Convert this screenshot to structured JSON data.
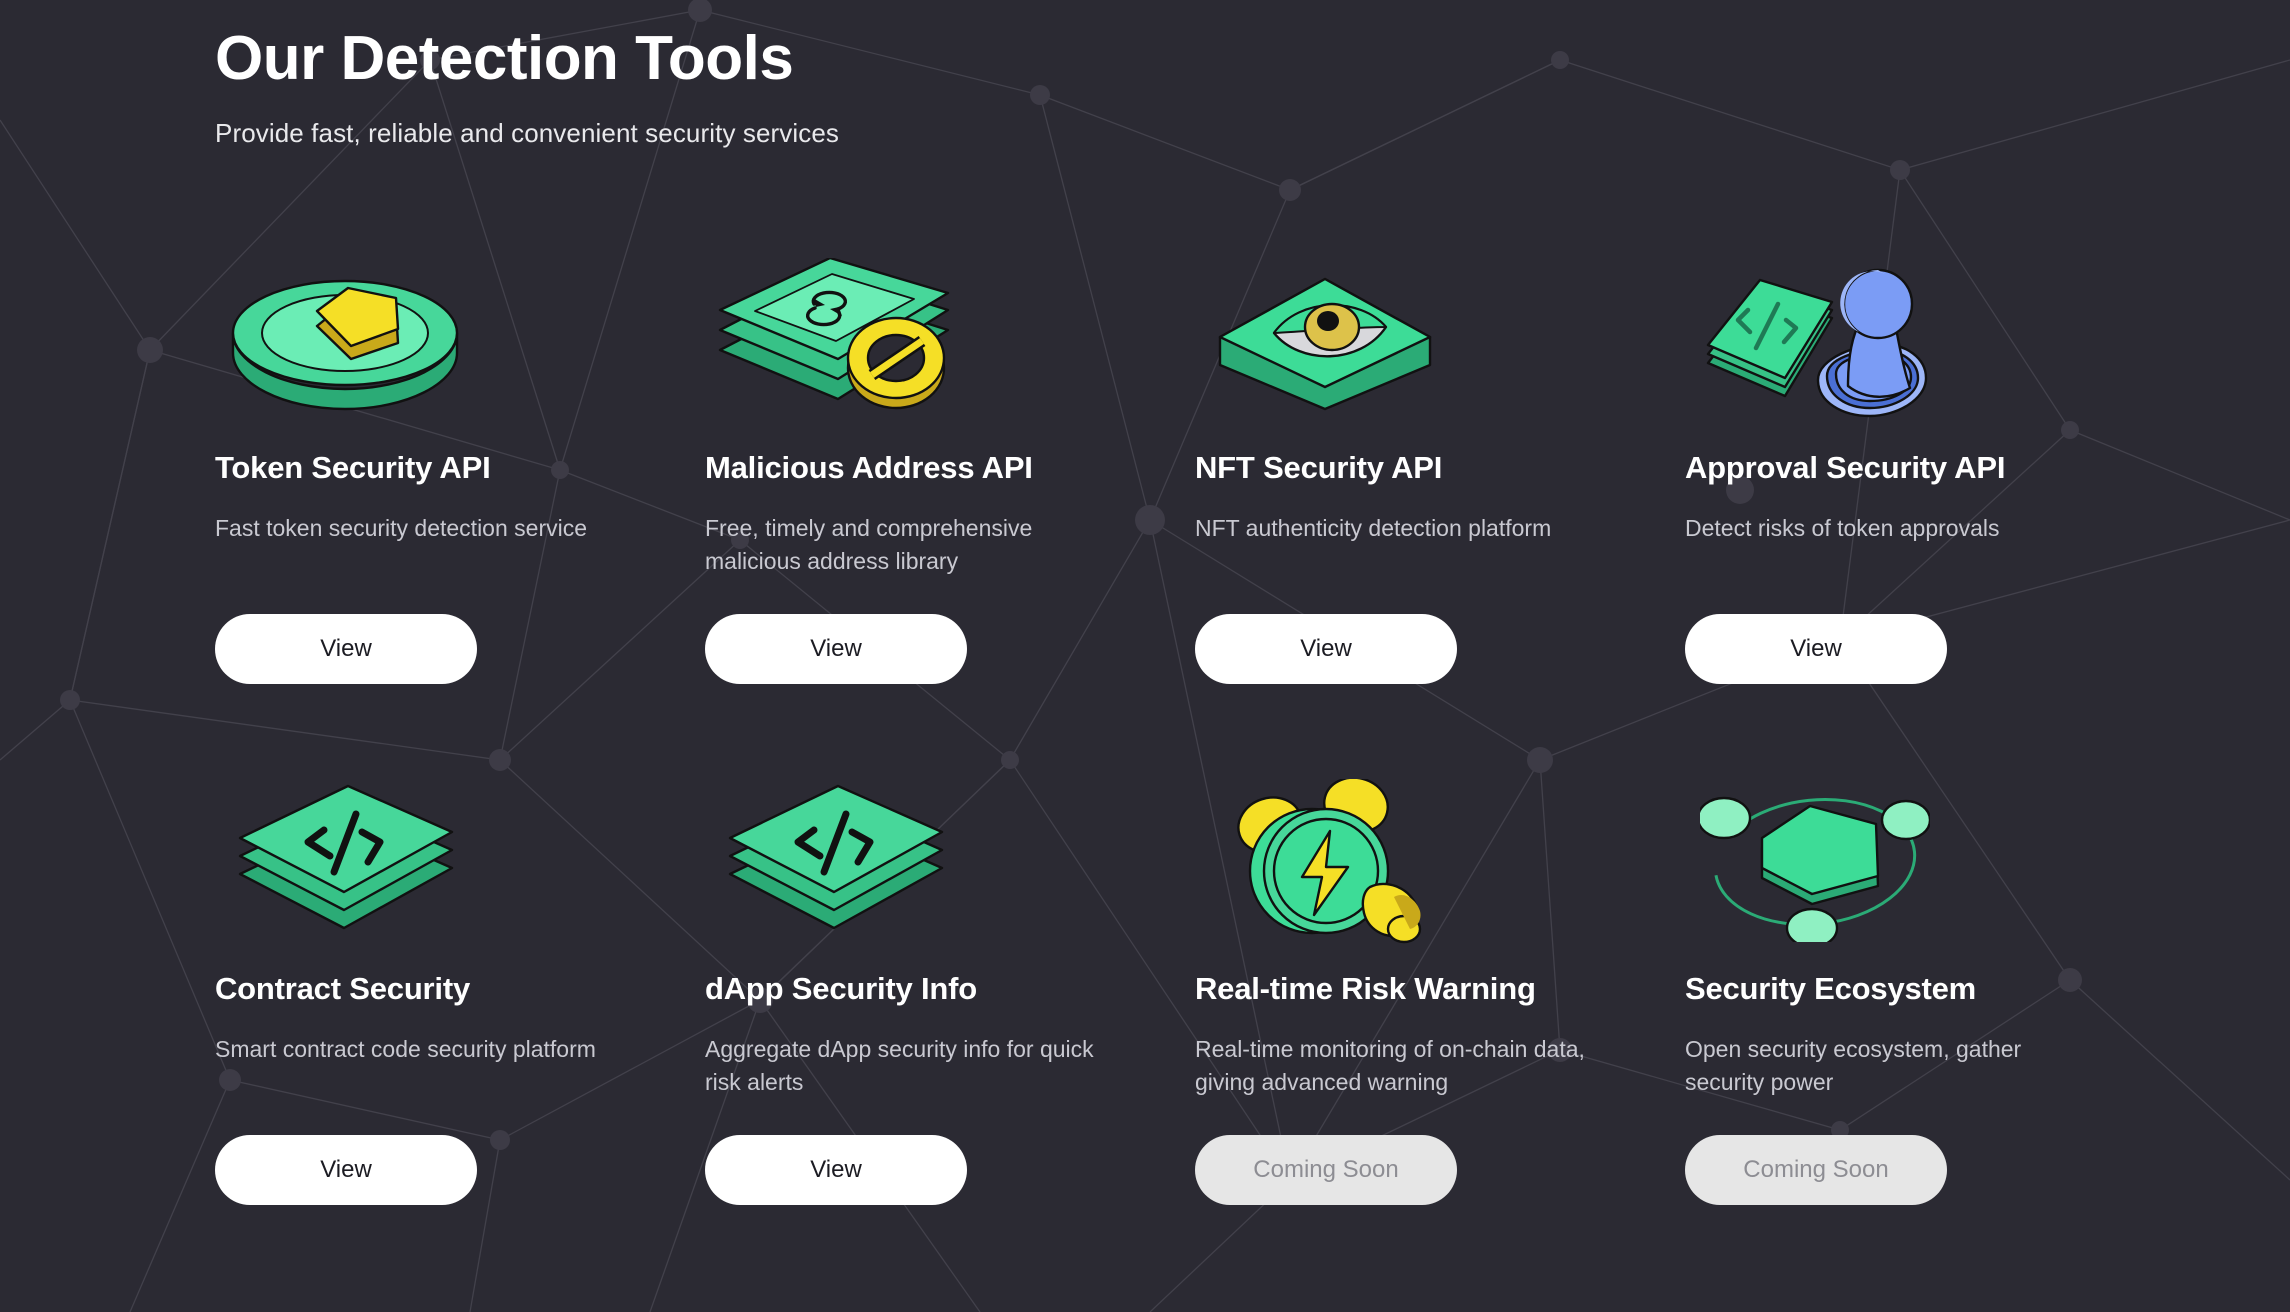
{
  "header": {
    "title": "Our Detection Tools",
    "subtitle": "Provide fast, reliable and convenient security services"
  },
  "colors": {
    "background": "#2b2a33",
    "title_text": "#ffffff",
    "body_text": "#c9c9d1",
    "button_active_bg": "#ffffff",
    "button_active_text": "#1b1b22",
    "button_disabled_bg": "#e6e6e6",
    "button_disabled_text": "#8d8d93",
    "accent_green": "#3ddc97",
    "accent_green_light": "#6ff0bb",
    "accent_green_dark": "#2bab76",
    "accent_yellow": "#f5df26",
    "accent_yellow_dark": "#c9a91a",
    "accent_blue": "#7b9cf5",
    "accent_blue_dark": "#4a6fd4"
  },
  "tools": [
    {
      "icon": "token-coin-icon",
      "title": "Token Security API",
      "description": "Fast token security detection service",
      "button_label": "View",
      "disabled": false
    },
    {
      "icon": "banknotes-blocked-icon",
      "title": "Malicious Address API",
      "description": "Free, timely and comprehensive malicious address library",
      "button_label": "View",
      "disabled": false
    },
    {
      "icon": "eye-slab-icon",
      "title": "NFT Security API",
      "description": "NFT authenticity detection platform",
      "button_label": "View",
      "disabled": false
    },
    {
      "icon": "stamp-approval-icon",
      "title": "Approval Security API",
      "description": "Detect risks of token approvals",
      "button_label": "View",
      "disabled": false
    },
    {
      "icon": "code-sheets-icon",
      "title": "Contract Security",
      "description": "Smart contract code security platform",
      "button_label": "View",
      "disabled": false
    },
    {
      "icon": "code-sheets-icon",
      "title": "dApp Security Info",
      "description": "Aggregate dApp security info for quick risk alerts",
      "button_label": "View",
      "disabled": false
    },
    {
      "icon": "alarm-clock-bolt-icon",
      "title": "Real-time Risk Warning",
      "description": "Real-time monitoring of on-chain data, giving advanced warning",
      "button_label": "Coming Soon",
      "disabled": true
    },
    {
      "icon": "orbit-pentagon-icon",
      "title": "Security Ecosystem",
      "description": "Open security ecosystem, gather security power",
      "button_label": "Coming Soon",
      "disabled": true
    }
  ]
}
